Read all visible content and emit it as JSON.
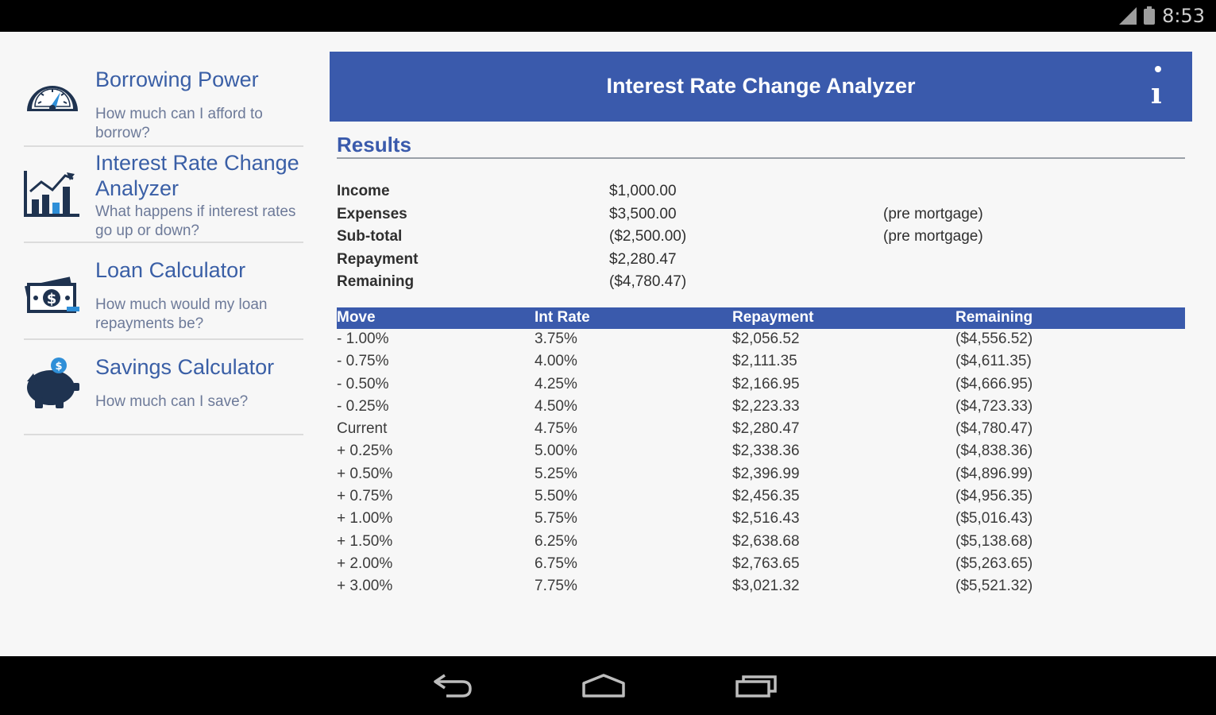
{
  "status_bar": {
    "time": "8:53"
  },
  "sidebar": {
    "items": [
      {
        "title": "Borrowing Power",
        "subtitle": "How much can I afford to borrow?",
        "icon": "speedometer-icon"
      },
      {
        "title": "Interest Rate Change Analyzer",
        "subtitle": "What happens if interest rates go up or down?",
        "icon": "bar-chart-icon"
      },
      {
        "title": "Loan Calculator",
        "subtitle": "How much would my loan repayments be?",
        "icon": "money-icon"
      },
      {
        "title": "Savings Calculator",
        "subtitle": "How much can I save?",
        "icon": "piggy-bank-icon"
      }
    ]
  },
  "header": {
    "title": "Interest Rate Change Analyzer",
    "info_icon": "info-icon"
  },
  "results": {
    "title": "Results",
    "summary": [
      {
        "label": "Income",
        "value": "$1,000.00",
        "note": ""
      },
      {
        "label": "Expenses",
        "value": "$3,500.00",
        "note": "(pre mortgage)"
      },
      {
        "label": "Sub-total",
        "value": "($2,500.00)",
        "note": "(pre mortgage)"
      },
      {
        "label": "Repayment",
        "value": "$2,280.47",
        "note": ""
      },
      {
        "label": "Remaining",
        "value": "($4,780.47)",
        "note": ""
      }
    ],
    "table": {
      "headers": [
        "Move",
        "Int Rate",
        "Repayment",
        "Remaining"
      ],
      "rows": [
        [
          "- 1.00%",
          "3.75%",
          "$2,056.52",
          "($4,556.52)"
        ],
        [
          "- 0.75%",
          "4.00%",
          "$2,111.35",
          "($4,611.35)"
        ],
        [
          "- 0.50%",
          "4.25%",
          "$2,166.95",
          "($4,666.95)"
        ],
        [
          "- 0.25%",
          "4.50%",
          "$2,223.33",
          "($4,723.33)"
        ],
        [
          "Current",
          "4.75%",
          "$2,280.47",
          "($4,780.47)"
        ],
        [
          "+ 0.25%",
          "5.00%",
          "$2,338.36",
          "($4,838.36)"
        ],
        [
          "+ 0.50%",
          "5.25%",
          "$2,396.99",
          "($4,896.99)"
        ],
        [
          "+ 0.75%",
          "5.50%",
          "$2,456.35",
          "($4,956.35)"
        ],
        [
          "+ 1.00%",
          "5.75%",
          "$2,516.43",
          "($5,016.43)"
        ],
        [
          "+ 1.50%",
          "6.25%",
          "$2,638.68",
          "($5,138.68)"
        ],
        [
          "+ 2.00%",
          "6.75%",
          "$2,763.65",
          "($5,263.65)"
        ],
        [
          "+ 3.00%",
          "7.75%",
          "$3,021.32",
          "($5,521.32)"
        ]
      ]
    }
  },
  "navigation_bar": {
    "icons": [
      "back-icon",
      "home-icon",
      "recents-icon"
    ]
  },
  "colors": {
    "accent": "#3a5aac",
    "link": "#3a5fa6",
    "icon": "#1f3350",
    "icon_accent": "#2f8fd8"
  }
}
